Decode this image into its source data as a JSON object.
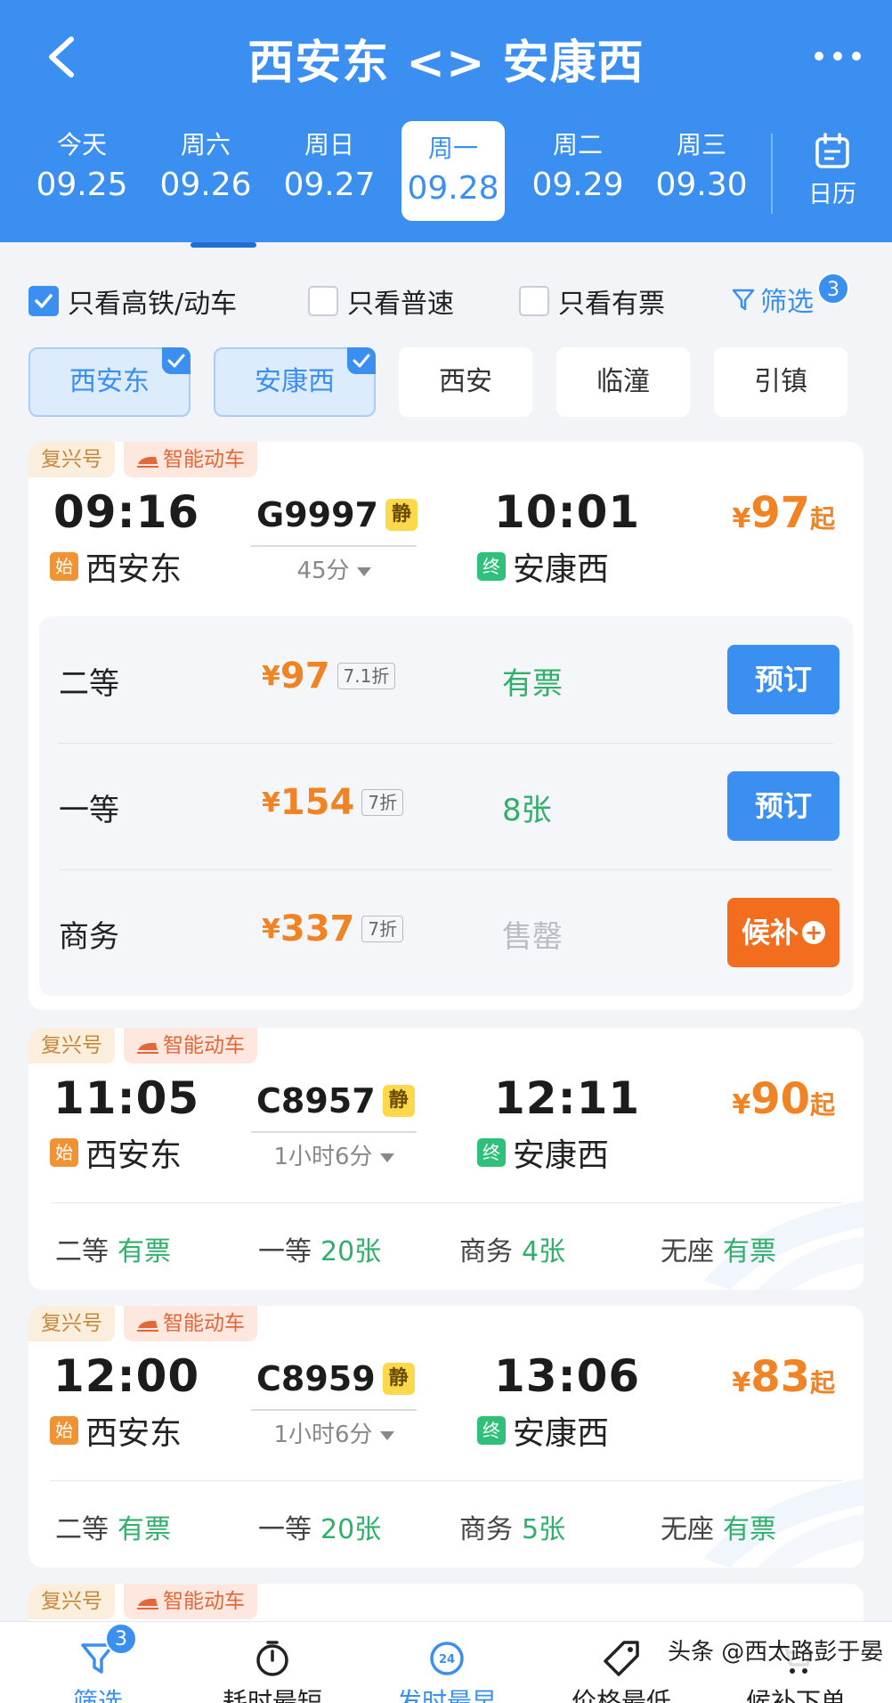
{
  "header": {
    "title": "西安东 <> 安康西",
    "dates": [
      {
        "weekday": "今天",
        "date": "09.25"
      },
      {
        "weekday": "周六",
        "date": "09.26"
      },
      {
        "weekday": "周日",
        "date": "09.27"
      },
      {
        "weekday": "周一",
        "date": "09.28"
      },
      {
        "weekday": "周二",
        "date": "09.29"
      },
      {
        "weekday": "周三",
        "date": "09.30"
      }
    ],
    "selected_date_index": 3,
    "calendar_label": "日历"
  },
  "filters": {
    "checkboxes": [
      {
        "label": "只看高铁/动车",
        "checked": true
      },
      {
        "label": "只看普速",
        "checked": false
      },
      {
        "label": "只看有票",
        "checked": false
      }
    ],
    "filter_label": "筛选",
    "filter_count": "3"
  },
  "stations": [
    {
      "name": "西安东",
      "selected": true
    },
    {
      "name": "安康西",
      "selected": true
    },
    {
      "name": "西安",
      "selected": false
    },
    {
      "name": "临潼",
      "selected": false
    },
    {
      "name": "引镇",
      "selected": false
    }
  ],
  "trains": [
    {
      "tag1": "复兴号",
      "tag2": "智能动车",
      "dep_time": "09:16",
      "arr_time": "10:01",
      "train_no": "G9997",
      "quiet_mark": "静",
      "duration": "45分",
      "from_mark": "始",
      "from": "西安东",
      "to_mark": "终",
      "to": "安康西",
      "currency": "¥",
      "price": "97",
      "price_suffix": "起",
      "seats": [
        {
          "name": "二等",
          "price": "97",
          "discount": "7.1折",
          "availability": "有票",
          "action": "预订"
        },
        {
          "name": "一等",
          "price": "154",
          "discount": "7折",
          "availability": "8张",
          "action": "预订"
        },
        {
          "name": "商务",
          "price": "337",
          "discount": "7折",
          "availability": "售罄",
          "action": "候补"
        }
      ]
    },
    {
      "tag1": "复兴号",
      "tag2": "智能动车",
      "dep_time": "11:05",
      "arr_time": "12:11",
      "train_no": "C8957",
      "quiet_mark": "静",
      "duration": "1小时6分",
      "from_mark": "始",
      "from": "西安东",
      "to_mark": "终",
      "to": "安康西",
      "currency": "¥",
      "price": "90",
      "price_suffix": "起",
      "summary": [
        {
          "name": "二等",
          "value": "有票"
        },
        {
          "name": "一等",
          "value": "20张"
        },
        {
          "name": "商务",
          "value": "4张"
        },
        {
          "name": "无座",
          "value": "有票"
        }
      ]
    },
    {
      "tag1": "复兴号",
      "tag2": "智能动车",
      "dep_time": "12:00",
      "arr_time": "13:06",
      "train_no": "C8959",
      "quiet_mark": "静",
      "duration": "1小时6分",
      "from_mark": "始",
      "from": "西安东",
      "to_mark": "终",
      "to": "安康西",
      "currency": "¥",
      "price": "83",
      "price_suffix": "起",
      "summary": [
        {
          "name": "二等",
          "value": "有票"
        },
        {
          "name": "一等",
          "value": "20张"
        },
        {
          "name": "商务",
          "value": "5张"
        },
        {
          "name": "无座",
          "value": "有票"
        }
      ]
    },
    {
      "tag1": "复兴号",
      "tag2": "智能动车"
    }
  ],
  "bottom_tabs": [
    {
      "label": "筛选",
      "icon": "filter-icon"
    },
    {
      "label": "耗时最短",
      "icon": "stopwatch-icon"
    },
    {
      "label": "发时最早",
      "icon": "clock-24-icon"
    },
    {
      "label": "价格最低",
      "icon": "price-tag-icon"
    },
    {
      "label": "候补下单",
      "icon": "waitlist-icon"
    }
  ],
  "bottom_badge": "3",
  "watermark": "头条 @西太路彭于晏",
  "colors": {
    "primary": "#3a8ff0",
    "price": "#f08323",
    "available": "#2fb06a",
    "waitlist": "#f26d1e"
  }
}
